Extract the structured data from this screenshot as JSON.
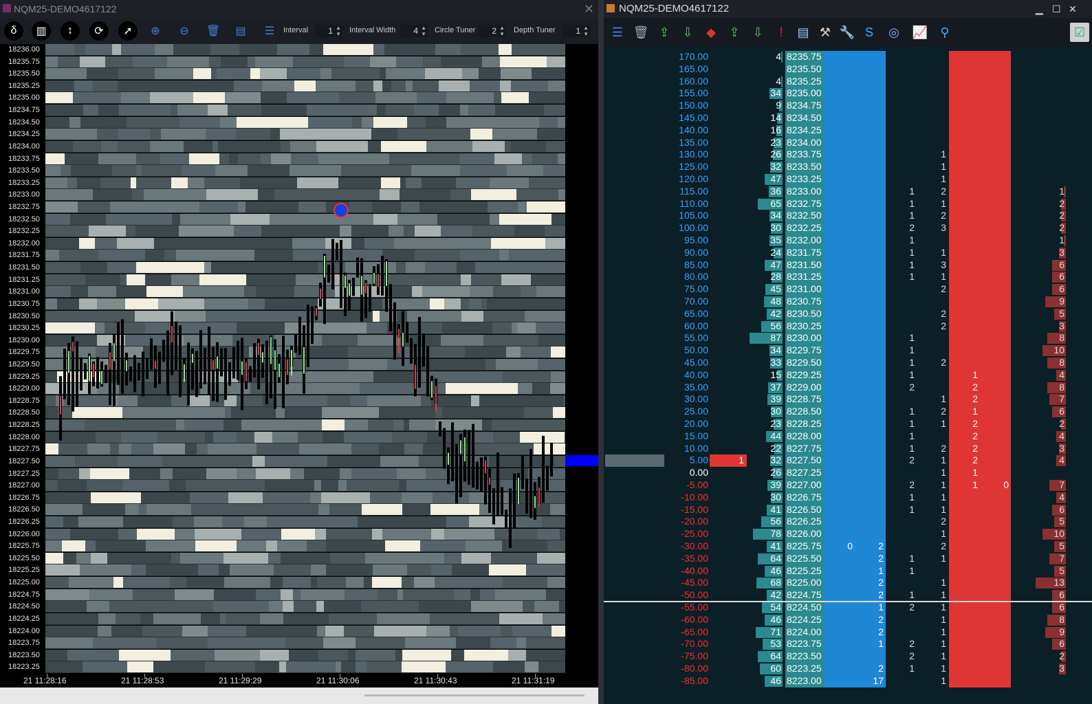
{
  "left_window": {
    "title": "NQM25-DEMO4617122",
    "toolbar": {
      "interval_label": "Interval",
      "interval_value": "1",
      "interval_width_label": "Interval Width",
      "interval_width_value": "4",
      "circle_tuner_label": "Circle Tuner",
      "circle_tuner_value": "2",
      "depth_tuner_label": "Depth Tuner",
      "depth_tuner_value": "1"
    },
    "price_labels": [
      "18236.00",
      "18235.75",
      "18235.50",
      "18235.25",
      "18235.00",
      "18234.75",
      "18234.50",
      "18234.25",
      "18234.00",
      "18233.75",
      "18233.50",
      "18233.25",
      "18233.00",
      "18232.75",
      "18232.50",
      "18232.25",
      "18232.00",
      "18231.75",
      "18231.50",
      "18231.25",
      "18231.00",
      "18230.75",
      "18230.50",
      "18230.25",
      "18230.00",
      "18229.75",
      "18229.50",
      "18229.25",
      "18229.00",
      "18228.75",
      "18228.50",
      "18228.25",
      "18228.00",
      "18227.75",
      "18227.50",
      "18227.25",
      "18227.00",
      "18226.75",
      "18226.50",
      "18226.25",
      "18226.00",
      "18225.75",
      "18225.50",
      "18225.25",
      "18225.00",
      "18224.75",
      "18224.50",
      "18224.25",
      "18224.00",
      "18223.75",
      "18223.50",
      "18223.25"
    ],
    "time_labels": [
      "21 11:28:16",
      "21 11:28:53",
      "21 11:29:29",
      "21 11:30:06",
      "21 11:30:43",
      "21 11:31:19"
    ]
  },
  "right_window": {
    "title": "NQM25-DEMO4617122",
    "window_controls": {
      "minimize": "▁",
      "maximize": "☐",
      "close": "✕"
    },
    "ladder": [
      {
        "pl": "170.00",
        "vol": "4",
        "price": "8235.75",
        "s1": "",
        "s2": "",
        "a1": "",
        "a2": "",
        "r": ""
      },
      {
        "pl": "165.00",
        "vol": "",
        "price": "8235.50",
        "s1": "",
        "s2": "",
        "a1": "",
        "a2": "",
        "r": ""
      },
      {
        "pl": "160.00",
        "vol": "4",
        "price": "8235.25",
        "s1": "",
        "s2": "",
        "a1": "",
        "a2": "",
        "r": ""
      },
      {
        "pl": "155.00",
        "vol": "34",
        "price": "8235.00",
        "s1": "",
        "s2": "",
        "a1": "",
        "a2": "",
        "r": ""
      },
      {
        "pl": "150.00",
        "vol": "9",
        "price": "8234.75",
        "s1": "",
        "s2": "",
        "a1": "",
        "a2": "",
        "r": ""
      },
      {
        "pl": "145.00",
        "vol": "14",
        "price": "8234.50",
        "s1": "",
        "s2": "",
        "a1": "",
        "a2": "",
        "r": ""
      },
      {
        "pl": "140.00",
        "vol": "16",
        "price": "8234.25",
        "s1": "",
        "s2": "",
        "a1": "",
        "a2": "",
        "r": ""
      },
      {
        "pl": "135.00",
        "vol": "23",
        "price": "8234.00",
        "s1": "",
        "s2": "",
        "a1": "",
        "a2": "",
        "r": ""
      },
      {
        "pl": "130.00",
        "vol": "26",
        "price": "8233.75",
        "s1": "",
        "s2": "1",
        "a1": "",
        "a2": "",
        "r": ""
      },
      {
        "pl": "125.00",
        "vol": "32",
        "price": "8233.50",
        "s1": "",
        "s2": "1",
        "a1": "",
        "a2": "",
        "r": ""
      },
      {
        "pl": "120.00",
        "vol": "47",
        "price": "8233.25",
        "s1": "",
        "s2": "1",
        "a1": "",
        "a2": "",
        "r": ""
      },
      {
        "pl": "115.00",
        "vol": "36",
        "price": "8233.00",
        "s1": "1",
        "s2": "2",
        "a1": "",
        "a2": "",
        "r": "1"
      },
      {
        "pl": "110.00",
        "vol": "65",
        "price": "8232.75",
        "s1": "1",
        "s2": "1",
        "a1": "",
        "a2": "",
        "r": "2"
      },
      {
        "pl": "105.00",
        "vol": "34",
        "price": "8232.50",
        "s1": "1",
        "s2": "2",
        "a1": "",
        "a2": "",
        "r": "2"
      },
      {
        "pl": "100.00",
        "vol": "30",
        "price": "8232.25",
        "s1": "2",
        "s2": "3",
        "a1": "",
        "a2": "",
        "r": "2"
      },
      {
        "pl": "95.00",
        "vol": "35",
        "price": "8232.00",
        "s1": "1",
        "s2": "",
        "a1": "",
        "a2": "",
        "r": "1"
      },
      {
        "pl": "90.00",
        "vol": "24",
        "price": "8231.75",
        "s1": "1",
        "s2": "1",
        "a1": "",
        "a2": "",
        "r": "3"
      },
      {
        "pl": "85.00",
        "vol": "47",
        "price": "8231.50",
        "s1": "1",
        "s2": "3",
        "a1": "",
        "a2": "",
        "r": "6"
      },
      {
        "pl": "80.00",
        "vol": "28",
        "price": "8231.25",
        "s1": "1",
        "s2": "1",
        "a1": "",
        "a2": "",
        "r": "6"
      },
      {
        "pl": "75.00",
        "vol": "45",
        "price": "8231.00",
        "s1": "",
        "s2": "2",
        "a1": "",
        "a2": "",
        "r": "6"
      },
      {
        "pl": "70.00",
        "vol": "48",
        "price": "8230.75",
        "s1": "",
        "s2": "",
        "a1": "",
        "a2": "",
        "r": "9"
      },
      {
        "pl": "65.00",
        "vol": "42",
        "price": "8230.50",
        "s1": "",
        "s2": "2",
        "a1": "",
        "a2": "",
        "r": "5"
      },
      {
        "pl": "60.00",
        "vol": "56",
        "price": "8230.25",
        "s1": "",
        "s2": "2",
        "a1": "",
        "a2": "",
        "r": "3"
      },
      {
        "pl": "55.00",
        "vol": "87",
        "price": "8230.00",
        "s1": "1",
        "s2": "",
        "a1": "",
        "a2": "",
        "r": "8"
      },
      {
        "pl": "50.00",
        "vol": "34",
        "price": "8229.75",
        "s1": "1",
        "s2": "",
        "a1": "",
        "a2": "",
        "r": "10"
      },
      {
        "pl": "45.00",
        "vol": "33",
        "price": "8229.50",
        "s1": "1",
        "s2": "2",
        "a1": "",
        "a2": "",
        "r": "8"
      },
      {
        "pl": "40.00",
        "vol": "15",
        "price": "8229.25",
        "s1": "1",
        "s2": "",
        "a1": "1",
        "a2": "",
        "r": "4"
      },
      {
        "pl": "35.00",
        "vol": "37",
        "price": "8229.00",
        "s1": "2",
        "s2": "",
        "a1": "2",
        "a2": "",
        "r": "8"
      },
      {
        "pl": "30.00",
        "vol": "39",
        "price": "8228.75",
        "s1": "",
        "s2": "1",
        "a1": "2",
        "a2": "",
        "r": "7"
      },
      {
        "pl": "25.00",
        "vol": "30",
        "price": "8228.50",
        "s1": "1",
        "s2": "2",
        "a1": "1",
        "a2": "",
        "r": "6"
      },
      {
        "pl": "20.00",
        "vol": "23",
        "price": "8228.25",
        "s1": "1",
        "s2": "1",
        "a1": "2",
        "a2": "",
        "r": "2"
      },
      {
        "pl": "15.00",
        "vol": "44",
        "price": "8228.00",
        "s1": "1",
        "s2": "",
        "a1": "2",
        "a2": "",
        "r": "4"
      },
      {
        "pl": "10.00",
        "vol": "22",
        "price": "8227.75",
        "s1": "1",
        "s2": "2",
        "a1": "2",
        "a2": "",
        "r": "3"
      },
      {
        "pl": "5.00",
        "vol": "32",
        "price": "8227.50",
        "s1": "2",
        "s2": "1",
        "a1": "2",
        "a2": "",
        "r": "4",
        "position": "1",
        "last": true
      },
      {
        "pl": "0.00",
        "vol": "26",
        "price": "8227.25",
        "s1": "",
        "s2": "1",
        "a1": "1",
        "a2": "",
        "r": ""
      },
      {
        "pl": "-5.00",
        "vol": "39",
        "price": "8227.00",
        "s1": "2",
        "s2": "1",
        "a1": "1",
        "a2": "0",
        "r": "7"
      },
      {
        "pl": "-10.00",
        "vol": "30",
        "price": "8226.75",
        "s1": "1",
        "s2": "1",
        "a1": "",
        "a2": "",
        "r": "4"
      },
      {
        "pl": "-15.00",
        "vol": "41",
        "price": "8226.50",
        "s1": "1",
        "s2": "1",
        "a1": "",
        "a2": "",
        "r": "6"
      },
      {
        "pl": "-20.00",
        "vol": "56",
        "price": "8226.25",
        "s1": "",
        "s2": "2",
        "a1": "",
        "a2": "",
        "r": "5"
      },
      {
        "pl": "-25.00",
        "vol": "78",
        "price": "8226.00",
        "s1": "",
        "s2": "1",
        "a1": "",
        "a2": "",
        "r": "10"
      },
      {
        "pl": "-30.00",
        "vol": "41",
        "price": "8225.75",
        "b1": "0",
        "b2": "2",
        "s1": "",
        "s2": "2",
        "a1": "",
        "a2": "",
        "r": "5"
      },
      {
        "pl": "-35.00",
        "vol": "64",
        "price": "8225.50",
        "b2": "2",
        "s1": "1",
        "s2": "1",
        "a1": "",
        "a2": "",
        "r": "7"
      },
      {
        "pl": "-40.00",
        "vol": "46",
        "price": "8225.25",
        "b2": "1",
        "s1": "1",
        "s2": "",
        "a1": "",
        "a2": "",
        "r": "5"
      },
      {
        "pl": "-45.00",
        "vol": "68",
        "price": "8225.00",
        "b2": "2",
        "s1": "",
        "s2": "1",
        "a1": "",
        "a2": "",
        "r": "13"
      },
      {
        "pl": "-50.00",
        "vol": "42",
        "price": "8224.75",
        "b2": "2",
        "s1": "1",
        "s2": "1",
        "a1": "",
        "a2": "",
        "r": "6"
      },
      {
        "pl": "-55.00",
        "vol": "54",
        "price": "8224.50",
        "b2": "1",
        "s1": "2",
        "s2": "1",
        "a1": "",
        "a2": "",
        "r": "6"
      },
      {
        "pl": "-60.00",
        "vol": "46",
        "price": "8224.25",
        "b2": "2",
        "s1": "",
        "s2": "1",
        "a1": "",
        "a2": "",
        "r": "8"
      },
      {
        "pl": "-65.00",
        "vol": "71",
        "price": "8224.00",
        "b2": "2",
        "s1": "",
        "s2": "1",
        "a1": "",
        "a2": "",
        "r": "9"
      },
      {
        "pl": "-70.00",
        "vol": "53",
        "price": "8223.75",
        "b2": "1",
        "s1": "2",
        "s2": "1",
        "a1": "",
        "a2": "",
        "r": "6"
      },
      {
        "pl": "-75.00",
        "vol": "64",
        "price": "8223.50",
        "b2": "",
        "s1": "2",
        "s2": "1",
        "a1": "",
        "a2": "",
        "r": "2"
      },
      {
        "pl": "-80.00",
        "vol": "60",
        "price": "8223.25",
        "b2": "2",
        "s1": "1",
        "s2": "1",
        "a1": "",
        "a2": "",
        "r": "3"
      },
      {
        "pl": "-85.00",
        "vol": "46",
        "price": "8223.00",
        "b2": "17",
        "s1": "",
        "s2": "1",
        "a1": "",
        "a2": "",
        "r": ""
      }
    ]
  }
}
